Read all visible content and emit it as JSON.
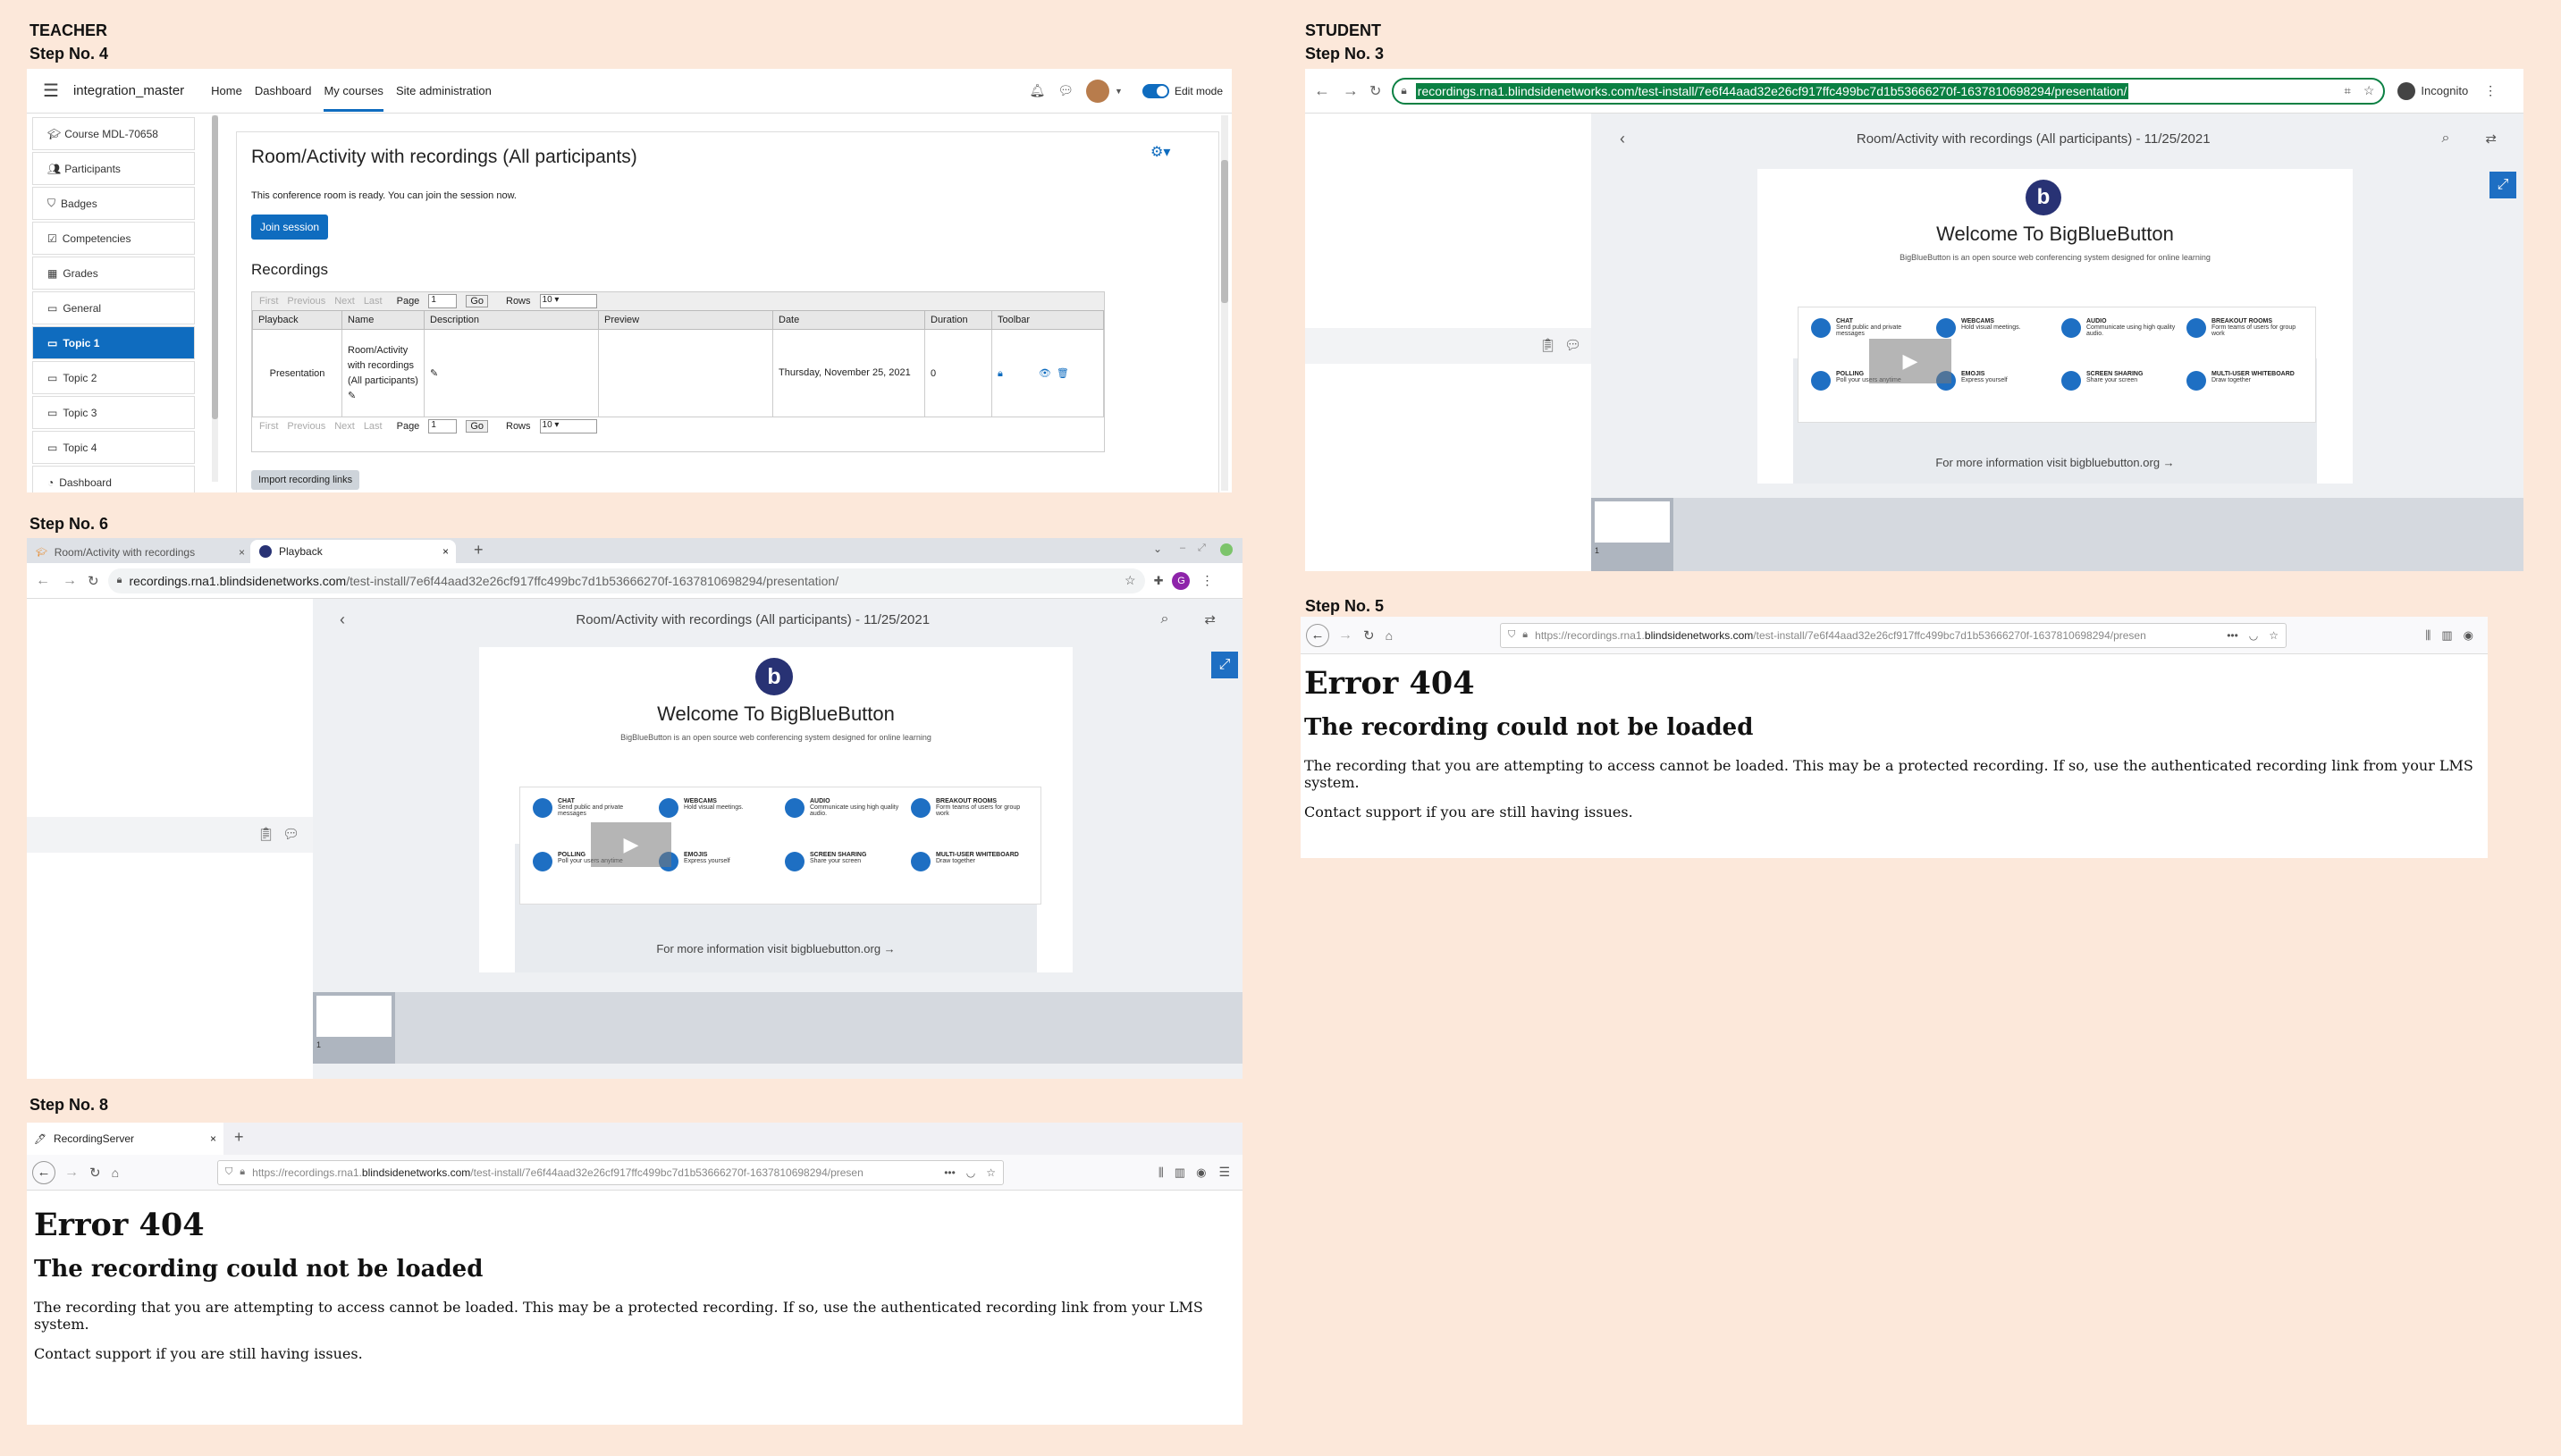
{
  "labels": {
    "teacher": "TEACHER",
    "student": "STUDENT",
    "step4": "Step No.  4",
    "step3": "Step No. 3",
    "step6": "Step No. 6",
    "step5": "Step No. 5",
    "step8": "Step No. 8"
  },
  "moodle": {
    "site_name": "integration_master",
    "nav": [
      "Home",
      "Dashboard",
      "My courses",
      "Site administration"
    ],
    "edit_mode": "Edit mode",
    "sidebar": [
      "Course MDL-70658",
      "Participants",
      "Badges",
      "Competencies",
      "Grades",
      "General",
      "Topic 1",
      "Topic 2",
      "Topic 3",
      "Topic 4",
      "Dashboard"
    ],
    "title": "Room/Activity with recordings (All participants)",
    "ready_text": "This conference room is ready. You can join the session now.",
    "join_button": "Join session",
    "recordings_heading": "Recordings",
    "pager": {
      "first": "First",
      "previous": "Previous",
      "next": "Next",
      "last": "Last",
      "page": "Page",
      "page_value": "1",
      "go": "Go",
      "rows": "Rows",
      "rows_value": "10"
    },
    "columns": [
      "Playback",
      "Name",
      "Description",
      "Preview",
      "Date",
      "Duration",
      "Toolbar"
    ],
    "row": {
      "playback": "Presentation",
      "name": "Room/Activity with recordings (All participants)",
      "date": "Thursday, November 25, 2021",
      "duration": "0"
    },
    "import_button": "Import recording links"
  },
  "chrome_student": {
    "url": "recordings.rna1.blindsidenetworks.com/test-install/7e6f44aad32e26cf917ffc499bc7d1b53666270f-1637810698294/presentation/",
    "incognito": "Incognito"
  },
  "player": {
    "title": "Room/Activity with recordings (All participants) - 11/25/2021",
    "welcome": "Welcome To BigBlueButton",
    "sub": "BigBlueButton is an open source web conferencing system designed for online learning",
    "more": "For more information visit bigbluebutton.org →",
    "features": [
      {
        "name": "CHAT",
        "desc": "Send public and private messages"
      },
      {
        "name": "WEBCAMS",
        "desc": "Hold visual meetings."
      },
      {
        "name": "AUDIO",
        "desc": "Communicate using high quality audio."
      },
      {
        "name": "BREAKOUT ROOMS",
        "desc": "Form teams of users for group work"
      },
      {
        "name": "POLLING",
        "desc": "Poll your users anytime"
      },
      {
        "name": "EMOJIS",
        "desc": "Express yourself"
      },
      {
        "name": "SCREEN SHARING",
        "desc": "Share your screen"
      },
      {
        "name": "MULTI-USER WHITEBOARD",
        "desc": "Draw together"
      }
    ],
    "thumb_num": "1"
  },
  "chrome_teacher": {
    "tab1": "Room/Activity with recordings",
    "tab2": "Playback",
    "url_host": "recordings.rna1.blindsidenetworks.com",
    "url_path": "/test-install/7e6f44aad32e26cf917ffc499bc7d1b53666270f-1637810698294/presentation/",
    "avatar": "G"
  },
  "firefox": {
    "tab": "RecordingServer",
    "url_pre": "https://recordings.rna1.",
    "url_host": "blindsidenetworks.com",
    "url_path": "/test-install/7e6f44aad32e26cf917ffc499bc7d1b53666270f-1637810698294/presen",
    "dots": "•••"
  },
  "error": {
    "h1": "Error 404",
    "h2": "The recording could not be loaded",
    "p1": "The recording that you are attempting to access cannot be loaded. This may be a protected recording. If so, use the authenticated recording link from your LMS system.",
    "p2": "Contact support if you are still having issues."
  },
  "colors": {
    "bg": "#fce8da",
    "moodle_blue": "#0f6cbf",
    "bbb_blue": "#1e6fc3",
    "chrome_green": "#0b8043"
  }
}
